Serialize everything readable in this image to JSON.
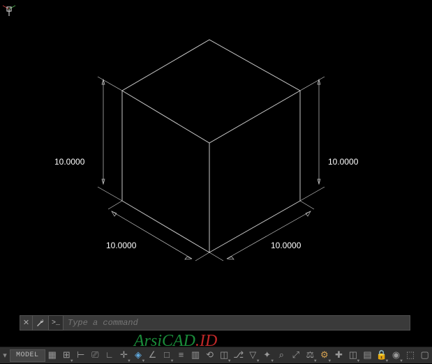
{
  "viewport": {
    "dimensions": {
      "front_left": "10.0000",
      "front_right": "10.0000",
      "height_left": "10.0000",
      "height_right": "10.0000"
    }
  },
  "commandbar": {
    "prompt_glyph": ">_",
    "placeholder": "Type a command"
  },
  "watermark": {
    "part1": "ArsiCAD",
    "part2": ".ID"
  },
  "statusbar": {
    "model_label": "MODEL",
    "buttons": [
      {
        "name": "drafting-grid-icon",
        "glyph": "▦"
      },
      {
        "name": "snap-mode-icon",
        "glyph": "⊞",
        "dd": true
      },
      {
        "name": "infer-constraints-icon",
        "glyph": "⊢"
      },
      {
        "name": "dynamic-input-icon",
        "glyph": "⎚"
      },
      {
        "name": "ortho-mode-icon",
        "glyph": "∟"
      },
      {
        "name": "polar-tracking-icon",
        "glyph": "✛",
        "dd": true
      },
      {
        "name": "isometric-drafting-icon",
        "glyph": "◈",
        "dd": true,
        "cls": "ico-blue"
      },
      {
        "name": "object-snap-tracking-icon",
        "glyph": "∠"
      },
      {
        "name": "object-snap-2d-icon",
        "glyph": "□",
        "dd": true
      },
      {
        "name": "lineweight-icon",
        "glyph": "≡"
      },
      {
        "name": "transparency-icon",
        "glyph": "▥"
      },
      {
        "name": "selection-cycling-icon",
        "glyph": "⟲"
      },
      {
        "name": "object-snap-3d-icon",
        "glyph": "◫",
        "dd": true
      },
      {
        "name": "dynamic-ucs-icon",
        "glyph": "⎇"
      },
      {
        "name": "selection-filter-icon",
        "glyph": "▽",
        "dd": true
      },
      {
        "name": "gizmo-icon",
        "glyph": "✦",
        "dd": true
      },
      {
        "name": "annotation-visibility-icon",
        "glyph": "⌕"
      },
      {
        "name": "autoscale-icon",
        "glyph": "⤢"
      },
      {
        "name": "annotation-scale-icon",
        "glyph": "⚖",
        "dd": true
      },
      {
        "name": "workspace-switching-icon",
        "glyph": "⚙",
        "dd": true,
        "cls": "ico-orange"
      },
      {
        "name": "annotation-monitor-icon",
        "glyph": "✚"
      },
      {
        "name": "units-icon",
        "glyph": "◫",
        "dd": true
      },
      {
        "name": "quick-properties-icon",
        "glyph": "▤"
      },
      {
        "name": "lock-ui-icon",
        "glyph": "🔒",
        "dd": true
      },
      {
        "name": "isolate-objects-icon",
        "glyph": "◉",
        "dd": true
      },
      {
        "name": "graphics-performance-icon",
        "glyph": "⬚"
      },
      {
        "name": "clean-screen-icon",
        "glyph": "▢"
      }
    ]
  }
}
